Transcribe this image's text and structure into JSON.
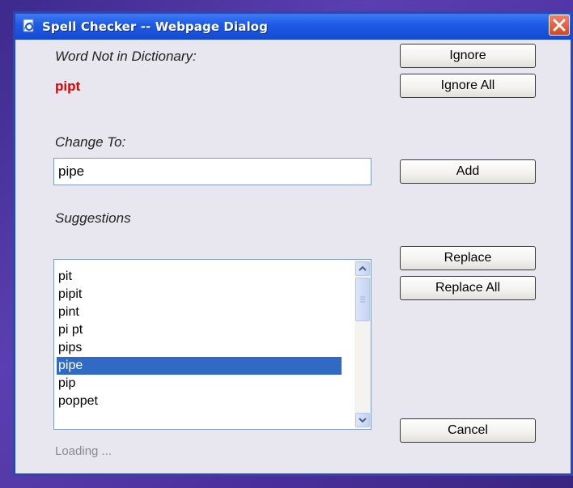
{
  "window": {
    "title": "Spell Checker -- Webpage Dialog",
    "title_icon": "ie-page-icon",
    "close_icon": "close-x-icon"
  },
  "labels": {
    "not_in_dictionary": "Word Not in Dictionary:",
    "misspelled_word": "pipt",
    "change_to": "Change To:",
    "suggestions": "Suggestions",
    "status": "Loading ..."
  },
  "change_to_value": "pipe",
  "buttons": {
    "ignore": "Ignore",
    "ignore_all": "Ignore All",
    "add": "Add",
    "replace": "Replace",
    "replace_all": "Replace All",
    "cancel": "Cancel"
  },
  "suggestions": [
    "pit",
    "pipit",
    "pint",
    "pi pt",
    "pips",
    "pipe",
    "pip",
    "poppet"
  ],
  "selected_suggestion": "pipe",
  "colors": {
    "misspelled": "#e00000",
    "selection": "#316ac5",
    "titlebar": "#1f5ce6"
  }
}
